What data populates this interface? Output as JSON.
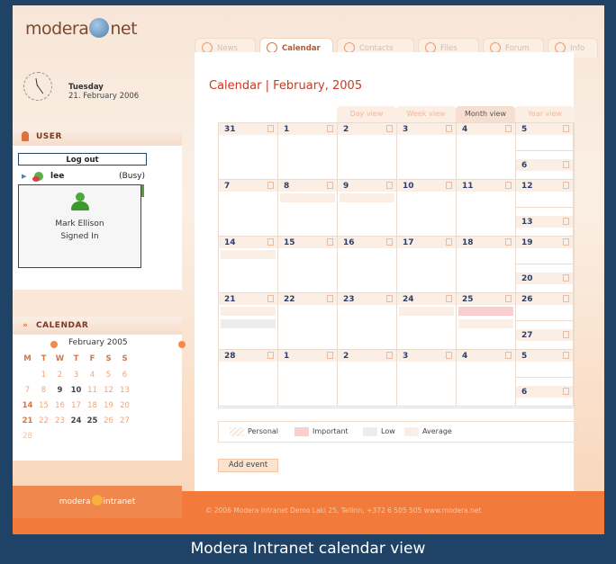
{
  "header": {
    "logo_left": "modera",
    "logo_right": "net",
    "tabs": [
      {
        "label": "News",
        "icon": "alert-icon"
      },
      {
        "label": "Calendar",
        "icon": "calendar-icon"
      },
      {
        "label": "Contacts",
        "icon": "contacts-icon"
      },
      {
        "label": "Files",
        "icon": "files-icon"
      },
      {
        "label": "Forum",
        "icon": "forum-icon"
      },
      {
        "label": "Info",
        "icon": "info-icon"
      }
    ],
    "active_tab": "Calendar"
  },
  "sidebar": {
    "date_day": "Tuesday",
    "date_full": "21. February 2006",
    "user_section": "USER",
    "logout_label": "Log out",
    "user_name": "lee",
    "user_status": "(Busy)",
    "popup_name": "Mark Ellison",
    "popup_status": "Signed In",
    "calendar_section": "CALENDAR",
    "mini_calendar": {
      "month": "February 2005",
      "weekdays": [
        "M",
        "T",
        "W",
        "T",
        "F",
        "S",
        "S"
      ],
      "days": [
        "1",
        "2",
        "3",
        "4",
        "5",
        "6",
        "7",
        "8",
        "9",
        "10",
        "11",
        "12",
        "13",
        "14",
        "15",
        "16",
        "17",
        "18",
        "19",
        "20",
        "21",
        "22",
        "23",
        "24",
        "25",
        "26",
        "27",
        "28"
      ]
    }
  },
  "main": {
    "title": "Calendar",
    "separator": "|",
    "month": "February, 2005",
    "view_tabs": [
      "Day view",
      "Week view",
      "Month view",
      "Year view"
    ],
    "active_view": "Month view",
    "weeks": [
      [
        "31",
        "1",
        "2",
        "3",
        "4",
        "5",
        "6"
      ],
      [
        "7",
        "8",
        "9",
        "10",
        "11",
        "12",
        "13"
      ],
      [
        "14",
        "15",
        "16",
        "17",
        "18",
        "19",
        "20"
      ],
      [
        "21",
        "22",
        "23",
        "24",
        "25",
        "26",
        "27"
      ],
      [
        "28",
        "1",
        "2",
        "3",
        "4",
        "5",
        "6"
      ]
    ],
    "legend": [
      "Personal",
      "Important",
      "Low",
      "Average"
    ],
    "add_event_label": "Add event"
  },
  "colors": {
    "accent": "#f27a3a",
    "important": "#f9cfd0",
    "low": "#ececec",
    "average": "#fbeee4",
    "date_text": "#2b3f6a"
  },
  "footer": {
    "logo_text_left": "modera",
    "logo_text_right": "intranet",
    "text": "© 2006 Modera Intranet Demo Laki 25, Tallinn, +372 6 505 505 www.modera.net"
  },
  "caption": "Modera Intranet calendar view"
}
